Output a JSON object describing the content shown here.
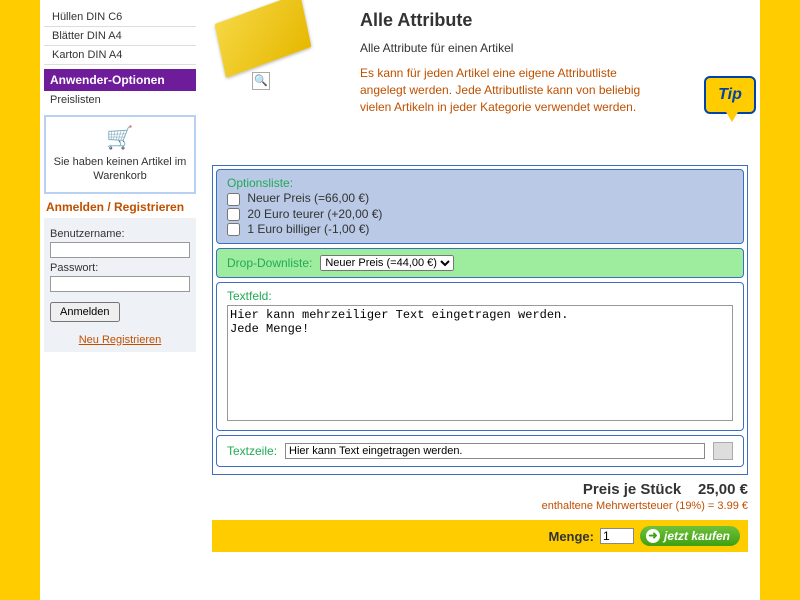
{
  "sidebar": {
    "nav": [
      {
        "label": "Hüllen DIN C6"
      },
      {
        "label": "Blätter DIN A4"
      },
      {
        "label": "Karton DIN A4"
      }
    ],
    "section_header": "Anwender-Optionen",
    "section_link": "Preislisten"
  },
  "cart": {
    "empty_text": "Sie haben keinen Artikel im Warenkorb"
  },
  "login": {
    "header": "Anmelden / Registrieren",
    "user_label": "Benutzername:",
    "pass_label": "Passwort:",
    "submit": "Anmelden",
    "register": "Neu Registrieren"
  },
  "product": {
    "title": "Alle Attribute",
    "subtitle": "Alle Attribute für einen Artikel",
    "description": "Es kann für jeden Artikel eine eigene Attributliste angelegt werden. Jede Attributliste kann von beliebig vielen Artikeln in jeder Kategorie verwendet werden.",
    "tip_label": "Tip"
  },
  "attributes": {
    "options_label": "Optionsliste:",
    "options": [
      {
        "label": "Neuer Preis  (=66,00 €)"
      },
      {
        "label": "20 Euro teurer  (+20,00 €)"
      },
      {
        "label": "1 Euro billiger  (-1,00 €)"
      }
    ],
    "dropdown_label": "Drop-Downliste:",
    "dropdown_selected": "Neuer Preis  (=44,00 €)",
    "textarea_label": "Textfeld:",
    "textarea_value": "Hier kann mehrzeiliger Text eingetragen werden.\nJede Menge!",
    "textline_label": "Textzeile:",
    "textline_value": "Hier kann Text eingetragen werden."
  },
  "pricing": {
    "price_label": "Preis je Stück",
    "price_value": "25,00  €",
    "vat_text": "enthaltene Mehrwertsteuer (19%) = 3.99  €"
  },
  "buy": {
    "qty_label": "Menge:",
    "qty_value": "1",
    "button": "jetzt kaufen"
  }
}
